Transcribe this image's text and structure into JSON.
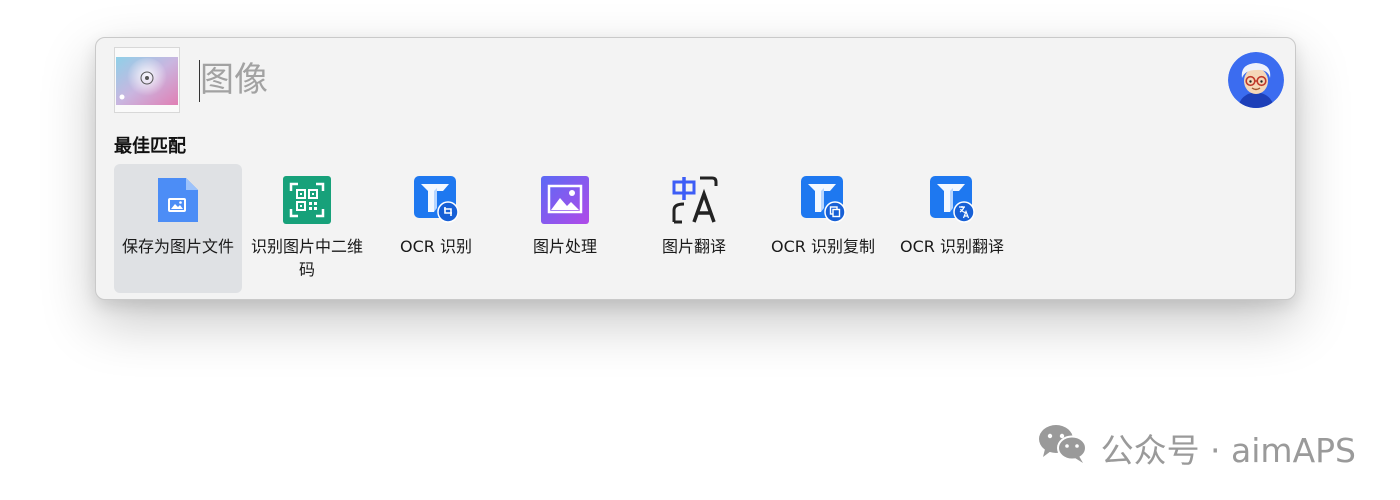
{
  "search": {
    "placeholder": "图像",
    "value": ""
  },
  "section": {
    "title": "最佳匹配"
  },
  "results": [
    {
      "label": "保存为图片文件",
      "icon": "save-image-file-icon",
      "selected": true
    },
    {
      "label": "识别图片中二维码",
      "icon": "qr-code-icon",
      "selected": false
    },
    {
      "label": "OCR 识别",
      "icon": "ocr-crop-icon",
      "selected": false
    },
    {
      "label": "图片处理",
      "icon": "image-processing-icon",
      "selected": false
    },
    {
      "label": "图片翻译",
      "icon": "translate-icon",
      "selected": false
    },
    {
      "label": "OCR 识别复制",
      "icon": "ocr-copy-icon",
      "selected": false
    },
    {
      "label": "OCR 识别翻译",
      "icon": "ocr-translate-icon",
      "selected": false
    }
  ],
  "watermark": {
    "text": "公众号 · aimAPS"
  },
  "colors": {
    "panel_bg": "#f3f3f3",
    "selected_tile": "#dfe1e4",
    "ocr_blue": "#1e78f0",
    "qr_green": "#17a17a",
    "translate_blue": "#3d5df6"
  }
}
